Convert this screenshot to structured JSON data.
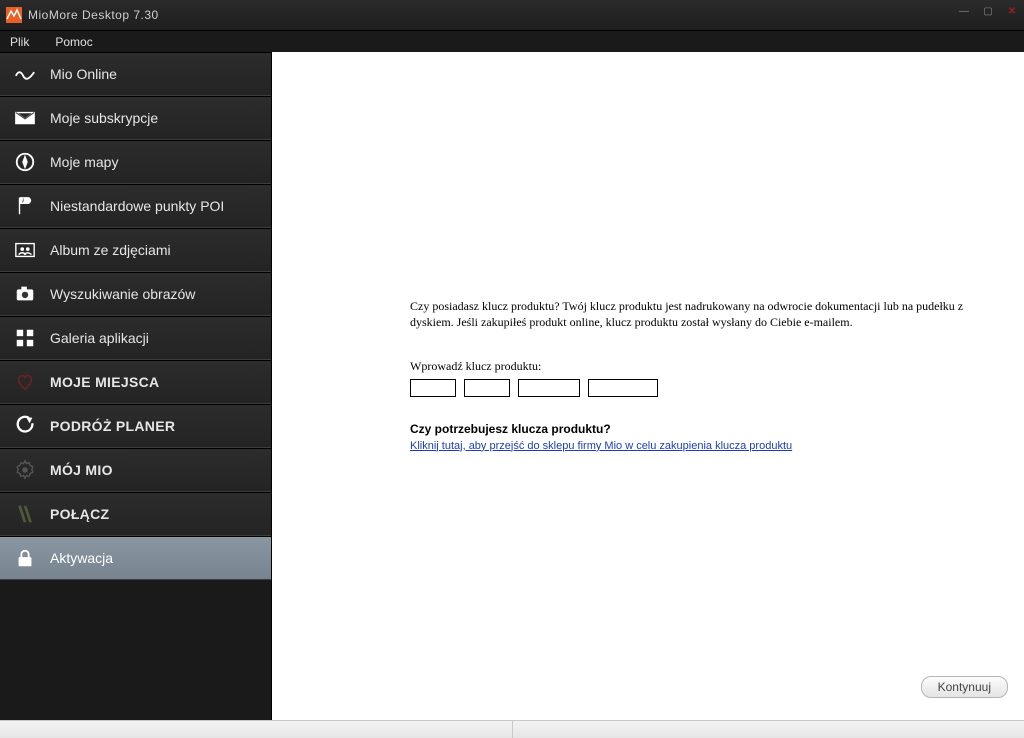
{
  "window": {
    "title": "MioMore Desktop 7.30"
  },
  "menu": {
    "file": "Plik",
    "help": "Pomoc"
  },
  "sidebar": {
    "items": [
      {
        "id": "mio-online",
        "label": "Mio Online",
        "bold": false
      },
      {
        "id": "subscriptions",
        "label": "Moje subskrypcje",
        "bold": false
      },
      {
        "id": "my-maps",
        "label": "Moje mapy",
        "bold": false
      },
      {
        "id": "custom-poi",
        "label": "Niestandardowe punkty POI",
        "bold": false
      },
      {
        "id": "photo-album",
        "label": "Album ze zdjęciami",
        "bold": false
      },
      {
        "id": "image-search",
        "label": "Wyszukiwanie obrazów",
        "bold": false
      },
      {
        "id": "app-gallery",
        "label": "Galeria aplikacji",
        "bold": false
      },
      {
        "id": "my-places",
        "label": "MOJE MIEJSCA",
        "bold": true
      },
      {
        "id": "trip-planner",
        "label": "PODRÓŻ PLANER",
        "bold": true
      },
      {
        "id": "my-mio",
        "label": "MÓJ MIO",
        "bold": true
      },
      {
        "id": "connect",
        "label": "POŁĄCZ",
        "bold": true
      },
      {
        "id": "activation",
        "label": "Aktywacja",
        "bold": false,
        "active": true
      }
    ]
  },
  "activation": {
    "intro": "Czy posiadasz klucz produktu? Twój klucz produktu jest nadrukowany na odwrocie dokumentacji lub na pudełku z dyskiem. Jeśli zakupiłeś produkt online, klucz produktu został wysłany do Ciebie e-mailem.",
    "enter_label": "Wprowadź klucz produktu:",
    "need_key_heading": "Czy potrzebujesz klucza produktu?",
    "shop_link_text": "Kliknij tutaj, aby przejść do sklepu firmy Mio w celu zakupienia klucza produktu",
    "continue_button": "Kontynuuj",
    "key_parts": [
      "",
      "",
      "",
      ""
    ]
  }
}
